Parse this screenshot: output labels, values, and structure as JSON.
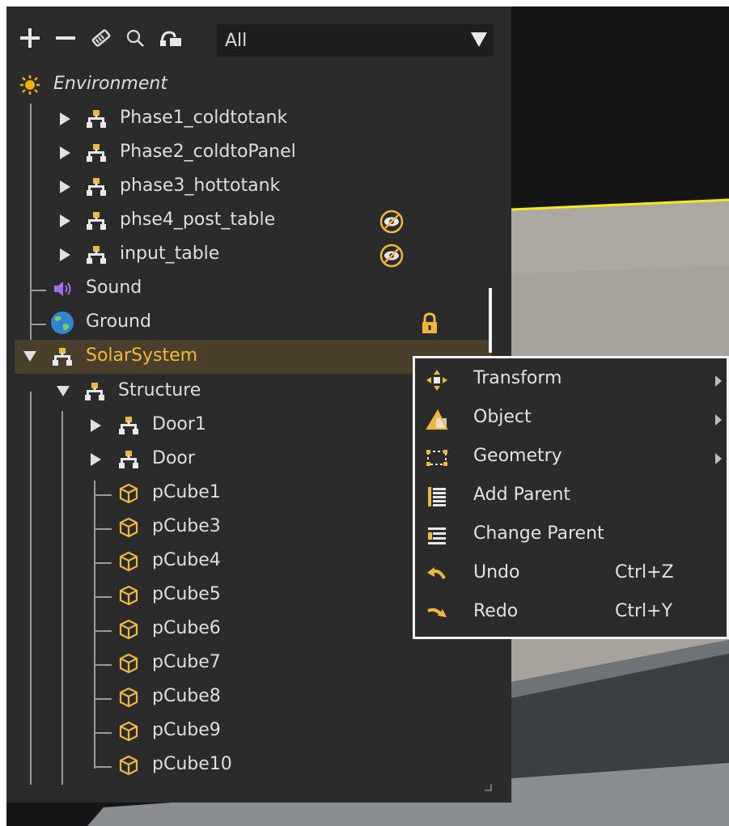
{
  "toolbar": {
    "icons": [
      "add-icon",
      "remove-icon",
      "tag-icon",
      "search-icon",
      "link-icon"
    ],
    "filter_value": "All"
  },
  "tree": {
    "environment": "Environment",
    "phase1": "Phase1_coldtotank",
    "phase2": "Phase2_coldtoPanel",
    "phase3": "phase3_hottotank",
    "phase4": "phse4_post_table",
    "input_table": "input_table",
    "sound": "Sound",
    "ground": "Ground",
    "solar_system": "SolarSystem",
    "structure": "Structure",
    "door1": "Door1",
    "door": "Door",
    "cubes": [
      "pCube1",
      "pCube3",
      "pCube4",
      "pCube5",
      "pCube6",
      "pCube7",
      "pCube8",
      "pCube9",
      "pCube10"
    ]
  },
  "context_menu": {
    "transform": "Transform",
    "object": "Object",
    "geometry": "Geometry",
    "add_parent": "Add Parent",
    "change_parent": "Change Parent",
    "undo": "Undo",
    "undo_shortcut": "Ctrl+Z",
    "redo": "Redo",
    "redo_shortcut": "Ctrl+Y"
  },
  "colors": {
    "accent": "#f0b73c",
    "panel": "#2b2b2b",
    "selected_row": "#4a3f2b"
  }
}
